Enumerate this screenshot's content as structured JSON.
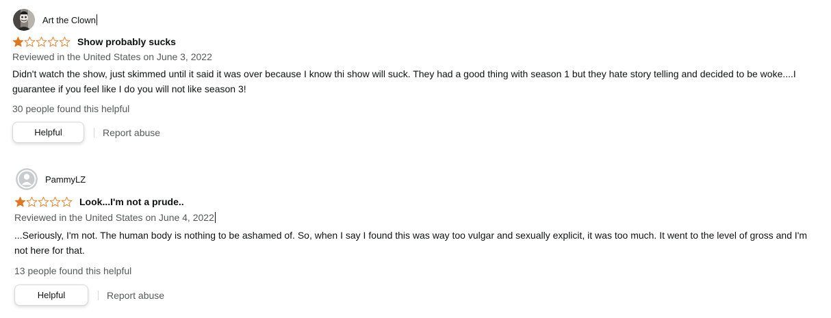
{
  "colors": {
    "star_filled": "#de7921",
    "star_outline": "#de7921",
    "text_primary": "#0f1111",
    "text_secondary": "#565959",
    "button_border": "#d5d9d9"
  },
  "reviews": [
    {
      "author": "Art the Clown",
      "avatar_icon": "user-photo",
      "rating": 1,
      "max_rating": 5,
      "title": "Show probably sucks",
      "meta": "Reviewed in the United States on June 3, 2022",
      "body": "Didn't watch the show, just skimmed until it said it was over because I know thi show will suck. They had a good thing with season 1 but they hate story telling and decided to be woke....I guarantee if you feel like I do you will not like season 3!",
      "helpful_count": "30 people found this helpful",
      "helpful_button": "Helpful",
      "report_link": "Report abuse"
    },
    {
      "author": "PammyLZ",
      "avatar_icon": "default-user-icon",
      "rating": 1,
      "max_rating": 5,
      "title": "Look...I'm not a prude..",
      "meta": "Reviewed in the United States on June 4, 2022",
      "body": "...Seriously, I'm not. The human body is nothing to be ashamed of. So, when I say I found this was way too vulgar and sexually explicit, it was too much. It went to the level of gross and I'm not here for that.",
      "helpful_count": "13 people found this helpful",
      "helpful_button": "Helpful",
      "report_link": "Report abuse"
    }
  ]
}
